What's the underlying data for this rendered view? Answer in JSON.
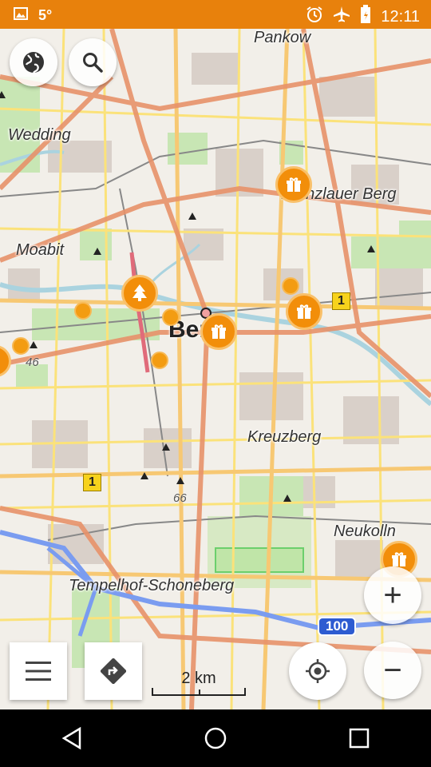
{
  "status_bar": {
    "temperature": "5°",
    "time": "12:11",
    "icons": [
      "image-icon",
      "alarm-icon",
      "airplane-icon",
      "battery-icon"
    ]
  },
  "map": {
    "district_labels": [
      "Pankow",
      "Wedding",
      "Prenzlauer Berg",
      "Moabit",
      "Kreuzberg",
      "Neukolln",
      "Tempelhof-Schoneberg"
    ],
    "city_label": "Berlin",
    "road_shields": [
      "1",
      "1"
    ],
    "highway_shield": "100",
    "road_numbers": [
      "46",
      "66"
    ],
    "colors": {
      "major_road": "#e8926a",
      "secondary_road": "#f7c873",
      "minor_road": "#fbe27a",
      "water": "#aad3df",
      "park": "#c8e6b4",
      "poi": "#f39c12",
      "status_bar": "#e8810c"
    }
  },
  "controls": {
    "layers_button_icon": "globe-icon",
    "search_button_icon": "search-icon",
    "menu_button_icon": "menu-icon",
    "directions_button_icon": "directions-icon",
    "locate_button_icon": "crosshair-icon",
    "zoom_in_label": "+",
    "zoom_out_label": "−"
  },
  "scale": {
    "label": "2 km"
  },
  "navigation_bar": {
    "icons": [
      "back-icon",
      "home-icon",
      "recents-icon"
    ]
  }
}
